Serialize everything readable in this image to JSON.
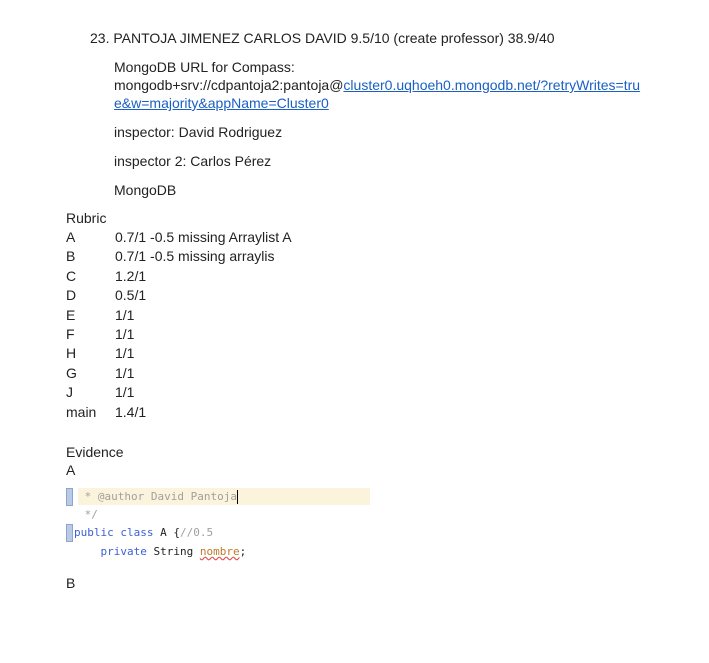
{
  "entry": {
    "heading": "23. PANTOJA JIMENEZ CARLOS DAVID  9.5/10 (create professor) 38.9/40",
    "mongo_label": "MongoDB URL for Compass:",
    "mongo_prefix": "mongodb+srv://cdpantoja2:pantoja@",
    "mongo_link_line1": "cluster0.uqhoeh0.mongodb.net/?retryWrites=tru",
    "mongo_link_line2": "e&w=majority&appName=Cluster0",
    "inspector": "inspector: David Rodriguez",
    "inspector2": "inspector 2: Carlos Pérez",
    "db": "MongoDB"
  },
  "rubric": {
    "title": "Rubric",
    "rows": [
      {
        "key": "A",
        "value": "0.7/1 -0.5 missing Arraylist A"
      },
      {
        "key": "B",
        "value": "0.7/1 -0.5 missing arraylis"
      },
      {
        "key": "C",
        "value": "1.2/1"
      },
      {
        "key": "D",
        "value": "0.5/1"
      },
      {
        "key": "E",
        "value": "1/1"
      },
      {
        "key": "F",
        "value": "1/1"
      },
      {
        "key": "H",
        "value": "1/1"
      },
      {
        "key": "G",
        "value": "1/1"
      },
      {
        "key": "J",
        "value": "1/1"
      },
      {
        "key": "main",
        "value": "1.4/1"
      }
    ]
  },
  "evidence": {
    "title": "Evidence",
    "section_a": "A",
    "code": {
      "line1": " * @author David Pantoja",
      "line2": " */",
      "line3_kw": "public class",
      "line3_name": " A {",
      "line3_cmt": "//0.5",
      "line4_kw": "    private",
      "line4_type": " String ",
      "line4_var": "nombre",
      "line4_end": ";"
    },
    "section_b": "B"
  }
}
